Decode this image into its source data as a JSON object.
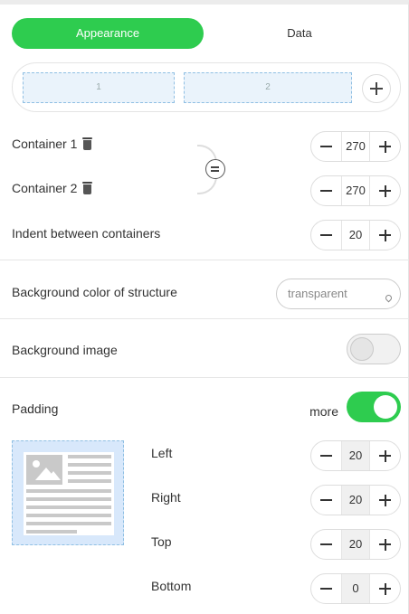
{
  "tabs": [
    {
      "label": "Appearance",
      "active": true
    },
    {
      "label": "Data",
      "active": false
    }
  ],
  "structure": {
    "cells": [
      "1",
      "2"
    ],
    "add_icon": "plus-icon"
  },
  "containers": [
    {
      "label": "Container 1",
      "value": "270",
      "icon": "trash-icon"
    },
    {
      "label": "Container 2",
      "value": "270",
      "icon": "trash-icon"
    }
  ],
  "indent": {
    "label": "Indent between containers",
    "value": "20"
  },
  "background_color": {
    "label": "Background color of structure",
    "placeholder": "transparent"
  },
  "background_image": {
    "label": "Background image",
    "enabled": false
  },
  "padding": {
    "label": "Padding",
    "more_label": "more",
    "enabled": true,
    "fields": [
      {
        "label": "Left",
        "value": "20"
      },
      {
        "label": "Right",
        "value": "20"
      },
      {
        "label": "Top",
        "value": "20"
      },
      {
        "label": "Bottom",
        "value": "0"
      }
    ]
  },
  "colors": {
    "accent": "#2ecc4f",
    "cell_fill": "#eaf3fb",
    "cell_border": "#8fbfe3"
  }
}
